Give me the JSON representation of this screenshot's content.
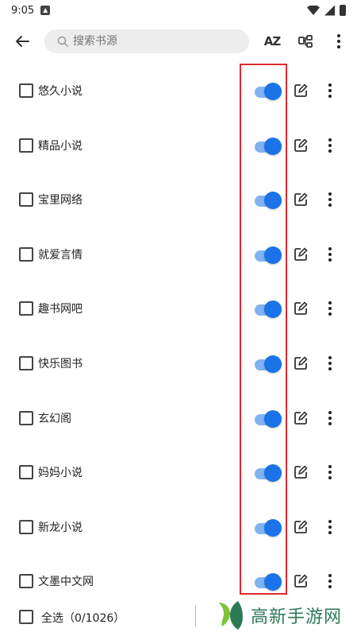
{
  "status_bar": {
    "time": "9:05"
  },
  "toolbar": {
    "search_placeholder": "搜索书源",
    "sort_label": "AZ"
  },
  "sources": [
    {
      "name": "悠久小说",
      "enabled": true
    },
    {
      "name": "精品小说",
      "enabled": true
    },
    {
      "name": "宝里网络",
      "enabled": true
    },
    {
      "name": "就爱言情",
      "enabled": true
    },
    {
      "name": "趣书网吧",
      "enabled": true
    },
    {
      "name": "快乐图书",
      "enabled": true
    },
    {
      "name": "玄幻阁",
      "enabled": true
    },
    {
      "name": "妈妈小说",
      "enabled": true
    },
    {
      "name": "新龙小说",
      "enabled": true
    },
    {
      "name": "文墨中文网",
      "enabled": true
    }
  ],
  "bottom": {
    "select_all": "全选（0/1026）"
  },
  "watermark": {
    "text": "高新手游网"
  },
  "colors": {
    "accent": "#1a73e8",
    "highlight": "#e0282e",
    "watermark": "#2b7a55"
  }
}
